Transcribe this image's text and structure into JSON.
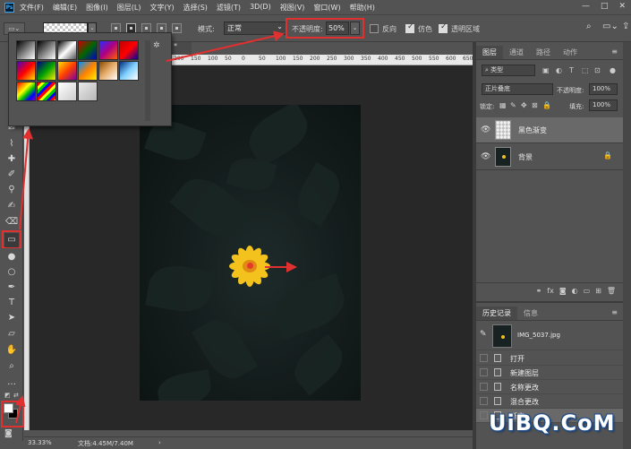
{
  "app": {
    "logo": "Ps"
  },
  "menubar": {
    "items": [
      "文件(F)",
      "编辑(E)",
      "图像(I)",
      "图层(L)",
      "文字(Y)",
      "选择(S)",
      "滤镜(T)",
      "3D(D)",
      "视图(V)",
      "窗口(W)",
      "帮助(H)"
    ],
    "window_controls": [
      "—",
      "□",
      "✕"
    ]
  },
  "options": {
    "mode_label": "模式:",
    "mode_value": "正常",
    "opacity_label": "不透明度:",
    "opacity_value": "50%",
    "reverse_label": "反向",
    "dither_label": "仿色",
    "transparency_label": "透明区域",
    "reverse_checked": false,
    "dither_checked": true,
    "transparency_checked": true
  },
  "gradient_presets": {
    "swatches": [
      "linear-gradient(135deg,#000 0%,#fff 100%)",
      "linear-gradient(135deg,#000 0%,#000 0%,#fff 100%)",
      "linear-gradient(135deg,#000 0%,#fff 50%,transparent 100%)",
      "linear-gradient(135deg,#c00 0%,#060 50%,#00c 100%)",
      "linear-gradient(135deg,#2a2aff 0%,#b00080 50%,#ff6000 100%)",
      "linear-gradient(135deg,#c00000 0%,#f00 50%,#00a 100%)",
      "linear-gradient(135deg,#5000c0 0%,#ff0000 50%,#ffe000 100%)",
      "linear-gradient(135deg,#000080 0%,#00a000 50%,#ffee00 100%)",
      "linear-gradient(135deg,#ffe000 0%,#ff4000 50%,#8000a0 100%)",
      "linear-gradient(135deg,#0090ff 0%,#ff8000 50%,#fff000 100%)",
      "linear-gradient(135deg,#8a4a00 0%,#e8b070 50%,#fff 100%)",
      "linear-gradient(135deg,#003080 0%,#80d0ff 50%,#fff 100%)",
      "linear-gradient(135deg,#ff0000,#ff8000,#ffff00,#00c000,#0000ff,#8000c0)",
      "repeating-linear-gradient(135deg,#f00 0 3px,#ff0 3px 6px,#0c0 6px 9px,#00f 9px 12px)",
      "linear-gradient(135deg,#ffffff 0%,#cccccc 100%)",
      "linear-gradient(135deg,#e8e8e8 0%,#b8b8b8 100%)"
    ]
  },
  "tools": {
    "icons": [
      "move-icon",
      "marquee-icon",
      "lasso-icon",
      "quick-select-icon",
      "crop-icon",
      "frame-icon",
      "eyedropper-icon",
      "healing-icon",
      "brush-icon",
      "stamp-icon",
      "history-brush-icon",
      "eraser-icon",
      "gradient-icon",
      "blur-icon",
      "dodge-icon",
      "pen-icon",
      "type-icon",
      "path-select-icon",
      "shape-icon",
      "hand-icon",
      "zoom-icon",
      "more-icon"
    ],
    "glyphs": [
      "✥",
      "⬚",
      "ʘ",
      "✎",
      "⌗",
      "⊠",
      "⌇",
      "✚",
      "✐",
      "⚲",
      "✍",
      "⌫",
      "▭",
      "●",
      "○",
      "✒",
      "T",
      "➤",
      "▱",
      "✋",
      "⌕",
      "…"
    ],
    "foreground_color": "#ffffff",
    "background_color": "#000000"
  },
  "document": {
    "tab_label": "*",
    "ruler_ticks": [
      "200",
      "150",
      "100",
      "50",
      "0",
      "50",
      "100",
      "150",
      "200",
      "250",
      "300",
      "350",
      "400",
      "450",
      "500",
      "550",
      "600",
      "650"
    ],
    "zoom": "33.33%",
    "doc_info": "文档:4.45M/7.40M"
  },
  "layers_panel": {
    "tabs": [
      "图层",
      "通道",
      "路径",
      "动作"
    ],
    "kind_label": "类型",
    "blend_mode": "正片叠底",
    "opacity_label": "不透明度:",
    "opacity_value": "100%",
    "lock_label": "锁定:",
    "fill_label": "填充:",
    "fill_value": "100%",
    "layers": [
      {
        "name": "黑色渐变",
        "thumb": "trans",
        "selected": true,
        "locked": false
      },
      {
        "name": "背景",
        "thumb": "photo",
        "selected": false,
        "locked": true
      }
    ],
    "footer_icons": [
      "link-icon",
      "fx-icon",
      "mask-icon",
      "adjustment-icon",
      "group-icon",
      "new-layer-icon",
      "trash-icon"
    ],
    "footer_glyphs": [
      "⚭",
      "fx",
      "◙",
      "◐",
      "▭",
      "⊞",
      "🗑"
    ]
  },
  "history_panel": {
    "tabs": [
      "历史记录",
      "信息"
    ],
    "snapshot_label": "IMG_5037.jpg",
    "steps": [
      "打开",
      "新建图层",
      "名称更改",
      "混合更改",
      "渐变"
    ]
  },
  "watermark": "UiBQ.CoM"
}
